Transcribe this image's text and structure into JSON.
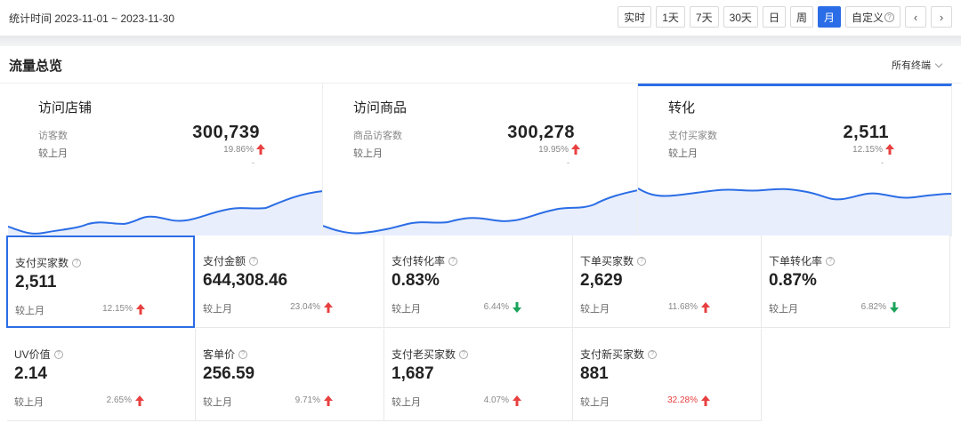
{
  "header": {
    "period_text": "统计时间 2023-11-01 ~ 2023-11-30",
    "ranges": [
      {
        "label": "实时",
        "active": false
      },
      {
        "label": "1天",
        "active": false
      },
      {
        "label": "7天",
        "active": false
      },
      {
        "label": "30天",
        "active": false
      },
      {
        "label": "日",
        "active": false
      },
      {
        "label": "周",
        "active": false
      },
      {
        "label": "月",
        "active": true
      },
      {
        "label": "自定义",
        "active": false
      }
    ],
    "prev_icon": "chevron-left-icon",
    "next_icon": "chevron-right-icon"
  },
  "section": {
    "title": "流量总览",
    "terminal_label": "所有终端"
  },
  "overview": [
    {
      "title": "访问店铺",
      "label": "访客数",
      "value": "300,739",
      "compare_label": "较上月",
      "pct": "19.86%",
      "trend": "up",
      "dash": "-",
      "selected": false
    },
    {
      "title": "访问商品",
      "label": "商品访客数",
      "value": "300,278",
      "compare_label": "较上月",
      "pct": "19.95%",
      "trend": "up",
      "dash": "-",
      "selected": false
    },
    {
      "title": "转化",
      "label": "支付买家数",
      "value": "2,511",
      "compare_label": "较上月",
      "pct": "12.15%",
      "trend": "up",
      "dash": "-",
      "selected": true
    }
  ],
  "metrics": [
    {
      "label": "支付买家数",
      "value": "2,511",
      "compare_label": "较上月",
      "pct": "12.15%",
      "trend": "up",
      "selected": true,
      "pct_red": false
    },
    {
      "label": "支付金额",
      "value": "644,308.46",
      "compare_label": "较上月",
      "pct": "23.04%",
      "trend": "up",
      "selected": false,
      "pct_red": false
    },
    {
      "label": "支付转化率",
      "value": "0.83%",
      "compare_label": "较上月",
      "pct": "6.44%",
      "trend": "down",
      "selected": false,
      "pct_red": false
    },
    {
      "label": "下单买家数",
      "value": "2,629",
      "compare_label": "较上月",
      "pct": "11.68%",
      "trend": "up",
      "selected": false,
      "pct_red": false
    },
    {
      "label": "下单转化率",
      "value": "0.87%",
      "compare_label": "较上月",
      "pct": "6.82%",
      "trend": "down",
      "selected": false,
      "pct_red": false
    },
    {
      "label": "UV价值",
      "value": "2.14",
      "compare_label": "较上月",
      "pct": "2.65%",
      "trend": "up",
      "selected": false,
      "pct_red": false
    },
    {
      "label": "客单价",
      "value": "256.59",
      "compare_label": "较上月",
      "pct": "9.71%",
      "trend": "up",
      "selected": false,
      "pct_red": false
    },
    {
      "label": "支付老买家数",
      "value": "1,687",
      "compare_label": "较上月",
      "pct": "4.07%",
      "trend": "up",
      "selected": false,
      "pct_red": false
    },
    {
      "label": "支付新买家数",
      "value": "881",
      "compare_label": "较上月",
      "pct": "32.28%",
      "trend": "up",
      "selected": false,
      "pct_red": true
    }
  ],
  "colors": {
    "accent": "#2b6de6",
    "up": "#e84040",
    "down": "#1aa35a",
    "spark_fill": "#e8eefb"
  }
}
